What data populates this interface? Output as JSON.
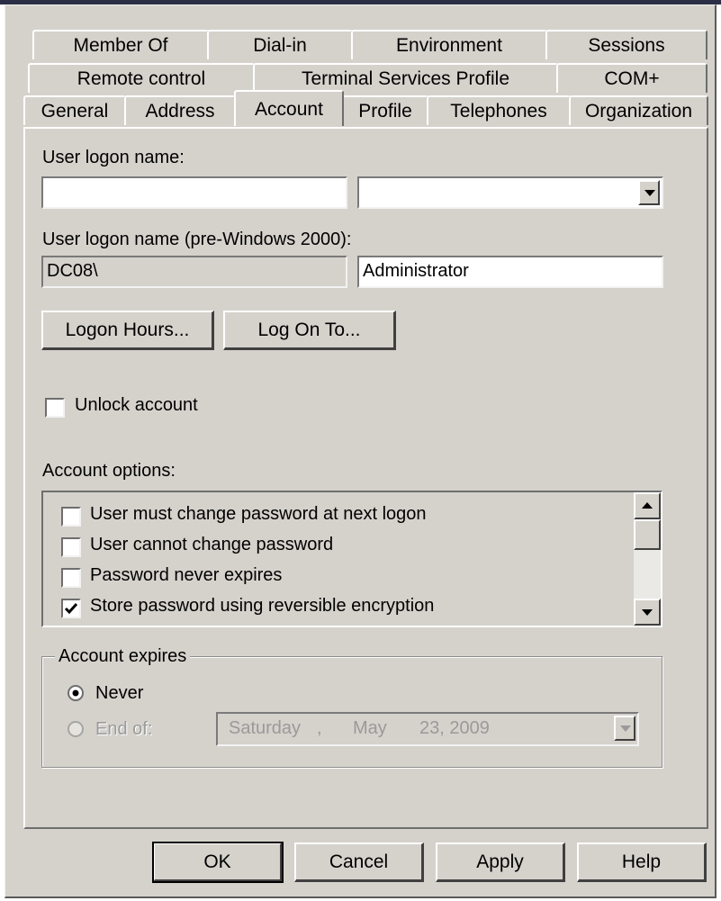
{
  "tabs": {
    "row1": [
      "Member Of",
      "Dial-in",
      "Environment",
      "Sessions"
    ],
    "row2": [
      "Remote control",
      "Terminal Services Profile",
      "COM+"
    ],
    "row3": [
      "General",
      "Address",
      "Account",
      "Profile",
      "Telephones",
      "Organization"
    ],
    "active": "Account"
  },
  "logon": {
    "label": "User logon name:",
    "name_value": "",
    "suffix_value": "",
    "pre2000_label": "User logon name (pre-Windows 2000):",
    "domain_value": "DC08\\",
    "user_value": "Administrator"
  },
  "buttons": {
    "logon_hours": "Logon Hours...",
    "log_on_to": "Log On To...",
    "ok": "OK",
    "cancel": "Cancel",
    "apply": "Apply",
    "help": "Help"
  },
  "unlock": {
    "label": "Unlock account",
    "checked": false
  },
  "account_options": {
    "label": "Account options:",
    "items": [
      {
        "label": "User must change password at next logon",
        "checked": false
      },
      {
        "label": "User cannot change password",
        "checked": false
      },
      {
        "label": "Password never expires",
        "checked": false
      },
      {
        "label": "Store password using reversible encryption",
        "checked": true
      }
    ]
  },
  "account_expires": {
    "legend": "Account expires",
    "never_label": "Never",
    "end_of_label": "End of:",
    "selected": "Never",
    "date": {
      "weekday": "Saturday",
      "sep": ",",
      "month": "May",
      "day_year": "23, 2009"
    }
  },
  "colors": {
    "dialog_face": "#d5d2cc",
    "field_bg": "#ffffff",
    "disabled_text": "#9a9a9a"
  }
}
